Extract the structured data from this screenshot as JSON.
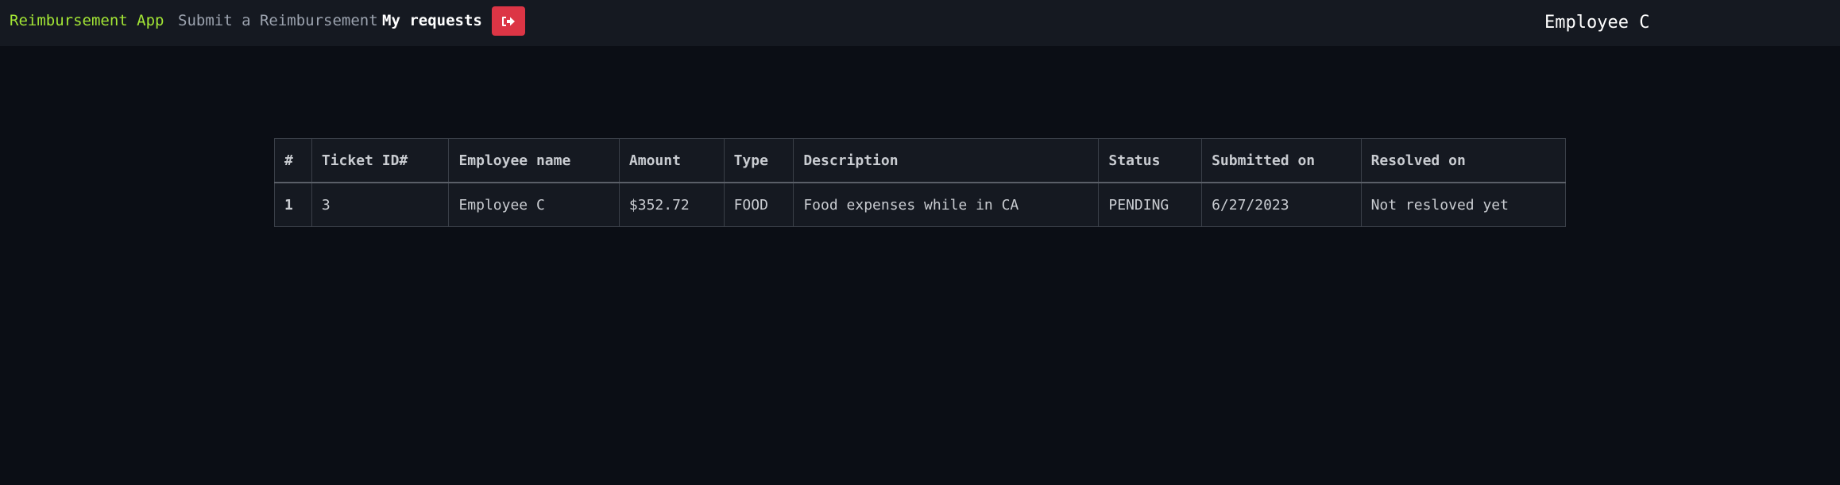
{
  "nav": {
    "brand": "Reimbursement App",
    "links": [
      "Submit a Reimbursement",
      "My requests"
    ],
    "logout_icon": "sign-out-icon",
    "user": "Employee C"
  },
  "colors": {
    "brand": "#a3e635",
    "logout_button": "#dc3545",
    "background": "#0b0e15",
    "navbar": "#151921"
  },
  "table": {
    "headers": [
      "#",
      "Ticket ID#",
      "Employee name",
      "Amount",
      "Type",
      "Description",
      "Status",
      "Submitted on",
      "Resolved on"
    ],
    "rows": [
      [
        "1",
        "3",
        "Employee C",
        "$352.72",
        "FOOD",
        "Food expenses while in CA",
        "PENDING",
        "6/27/2023",
        "Not resloved yet"
      ]
    ]
  }
}
